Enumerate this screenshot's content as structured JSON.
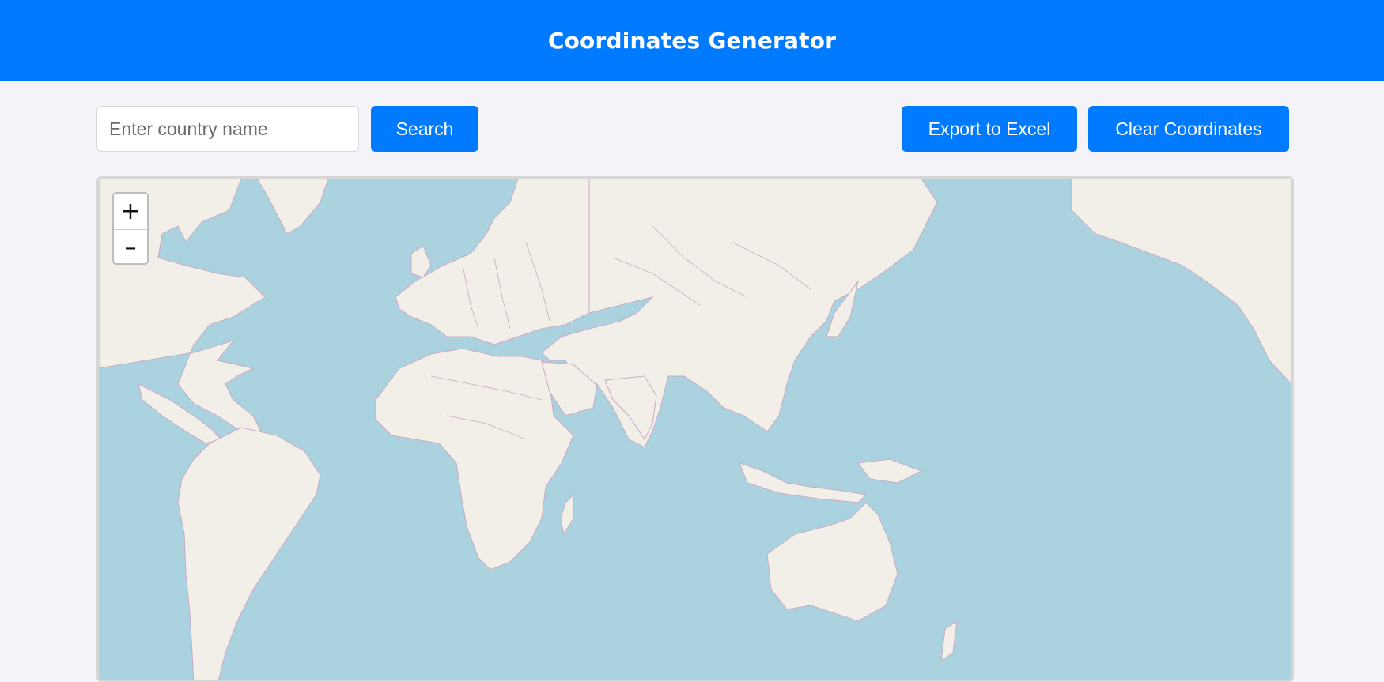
{
  "header": {
    "title": "Coordinates Generator"
  },
  "search": {
    "placeholder": "Enter country name",
    "value": "",
    "button_label": "Search"
  },
  "actions": {
    "export_label": "Export to Excel",
    "clear_label": "Clear Coordinates"
  },
  "map": {
    "zoom_in_label": "+",
    "zoom_out_label": "–",
    "colors": {
      "water": "#aad3df",
      "land": "#f2efe9",
      "border": "#c9a9c4"
    }
  }
}
